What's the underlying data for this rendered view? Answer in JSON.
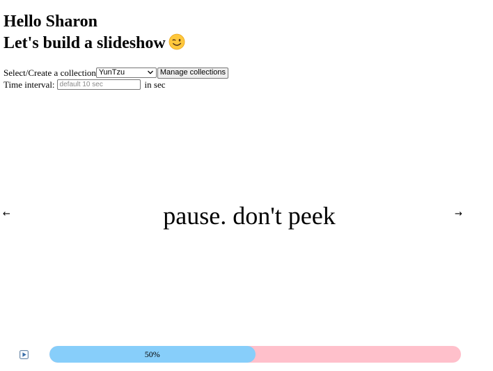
{
  "header": {
    "greeting": "Hello Sharon",
    "tagline": "Let's build a slideshow",
    "tagline_emoji": "winking-face"
  },
  "controls": {
    "collection_label": "Select/Create a collection",
    "collection_selected": "YunTzu",
    "manage_button_label": "Manage collections",
    "interval_label": "Time interval:",
    "interval_placeholder": "default 10 sec",
    "interval_value": "",
    "interval_unit": "in sec"
  },
  "slide": {
    "text": "pause. don't peek",
    "prev_arrow": "←",
    "next_arrow": "→"
  },
  "player": {
    "play_icon": "play-icon",
    "progress_label": "50%",
    "progress_fraction": 0.5,
    "colors": {
      "progress_fill": "#87cefa",
      "progress_track": "#ffc0cb",
      "play_icon": "#3b6fa8"
    }
  }
}
